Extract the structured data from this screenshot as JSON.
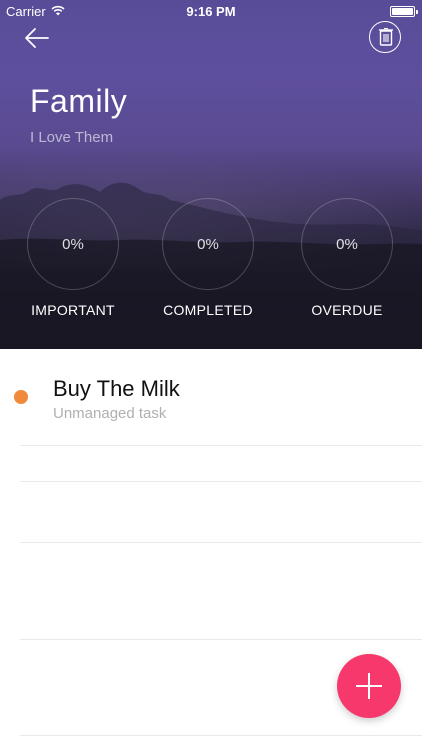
{
  "status_bar": {
    "carrier": "Carrier",
    "time": "9:16 PM",
    "wifi_icon": "wifi-icon",
    "battery_icon": "battery-icon"
  },
  "header": {
    "back_icon": "arrow-left-icon",
    "delete_icon": "trash-icon",
    "title": "Family",
    "subtitle": "I Love Them",
    "stats": [
      {
        "value": "0%",
        "label": "IMPORTANT"
      },
      {
        "value": "0%",
        "label": "COMPLETED"
      },
      {
        "value": "0%",
        "label": "OVERDUE"
      }
    ]
  },
  "tasks": [
    {
      "title": "Buy The Milk",
      "subtitle": "Unmanaged task",
      "dot_color": "#f08a3c"
    }
  ],
  "fab": {
    "icon": "plus-icon"
  },
  "colors": {
    "accent": "#f7386c",
    "task_dot": "#f08a3c",
    "header_top": "#584c98"
  }
}
